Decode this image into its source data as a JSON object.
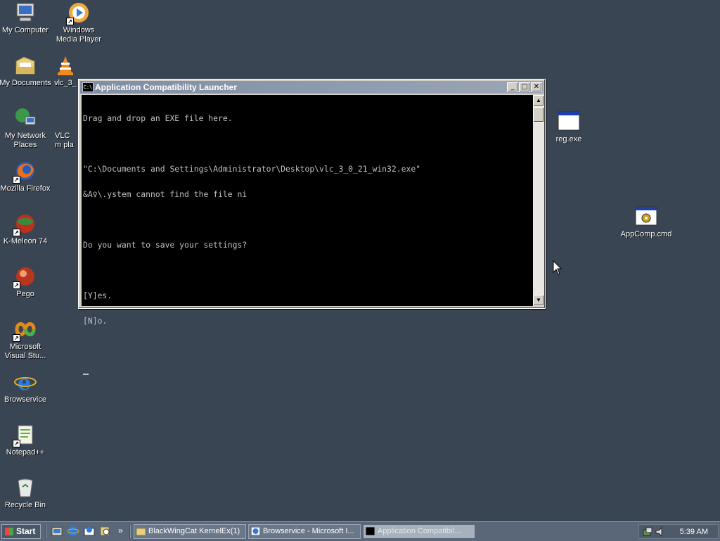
{
  "desktop_icons": [
    {
      "label": "My Computer"
    },
    {
      "label": "Windows Media Player"
    },
    {
      "label": "My Documents"
    },
    {
      "label": "vlc_3_"
    },
    {
      "label": "My Network Places"
    },
    {
      "label": "VLC m pla"
    },
    {
      "label": "Mozilla Firefox"
    },
    {
      "label": "K-Meleon 74"
    },
    {
      "label": "Pego"
    },
    {
      "label": "Microsoft Visual Stu..."
    },
    {
      "label": "Browservice"
    },
    {
      "label": "Notepad++"
    },
    {
      "label": "Recycle Bin"
    },
    {
      "label": "reg.exe"
    },
    {
      "label": "AppComp.cmd"
    }
  ],
  "console": {
    "title": "Application Compatibility Launcher",
    "icon_text": "C:\\",
    "lines": [
      "Drag and drop an EXE file here.",
      "",
      "\"C:\\Documents and Settings\\Administrator\\Desktop\\vlc_3_0_21_win32.exe\"",
      "&A♀\\.ystem cannot find the file ni",
      "",
      "Do you want to save your settings?",
      "",
      "[Y]es.",
      "[N]o.",
      ""
    ],
    "buttons": {
      "minimize": "_",
      "maximize": "□",
      "close": "✕"
    }
  },
  "taskbar": {
    "start_label": "Start",
    "tasks": [
      {
        "label": "BlackWingCat KernelEx(1)"
      },
      {
        "label": "Browservice - Microsoft I..."
      },
      {
        "label": "Application Compatibil..."
      }
    ],
    "clock": "5:39 AM",
    "quicklaunch_more": "»"
  },
  "colors": {
    "desktop": "#3a4553",
    "console_bg": "#000000",
    "console_text": "#c0c0c0"
  }
}
